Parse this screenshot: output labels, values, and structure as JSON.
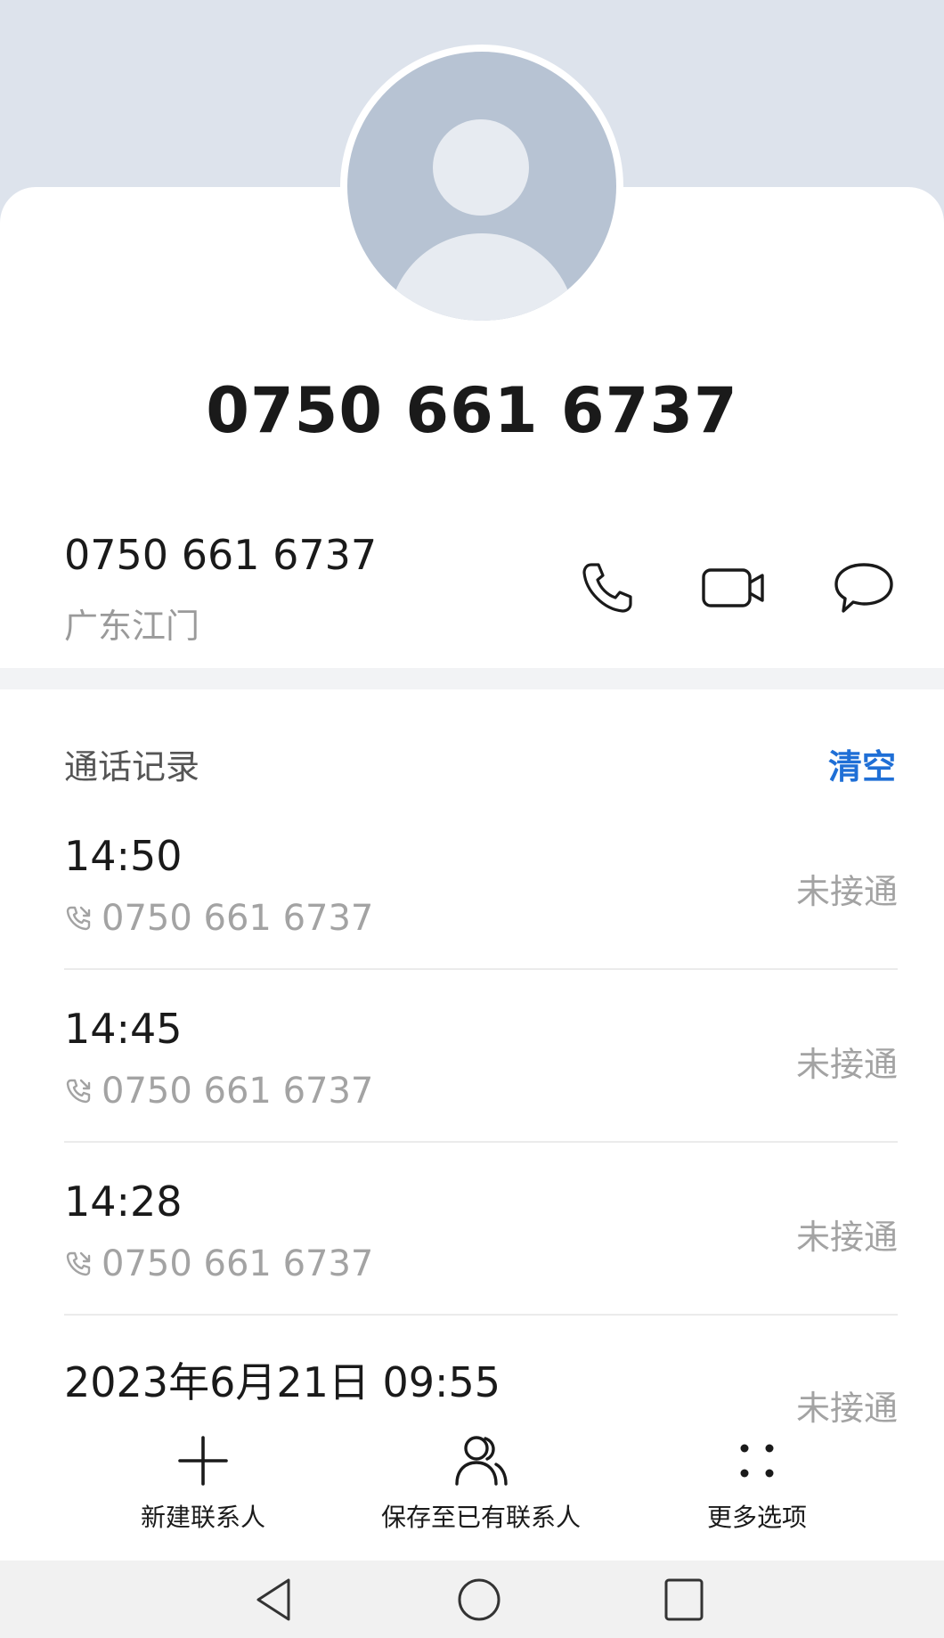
{
  "contact": {
    "title_number": "0750 661 6737",
    "number": "0750 661 6737",
    "location": "广东江门"
  },
  "actions": {
    "call_icon": "phone-icon",
    "video_icon": "video-camera-icon",
    "message_icon": "message-bubble-icon"
  },
  "call_log": {
    "title": "通话记录",
    "clear_label": "清空",
    "records": [
      {
        "time": "14:50",
        "number": "0750 661 6737",
        "status": "未接通"
      },
      {
        "time": "14:45",
        "number": "0750 661 6737",
        "status": "未接通"
      },
      {
        "time": "14:28",
        "number": "0750 661 6737",
        "status": "未接通"
      },
      {
        "time": "2023年6月21日 09:55",
        "number": "",
        "status": "未接通"
      }
    ]
  },
  "bottom_bar": {
    "new_contact": "新建联系人",
    "save_existing": "保存至已有联系人",
    "more_options": "更多选项"
  },
  "colors": {
    "accent": "#1f6fd6",
    "header_bg": "#dde3ec",
    "avatar": "#b7c3d3"
  }
}
